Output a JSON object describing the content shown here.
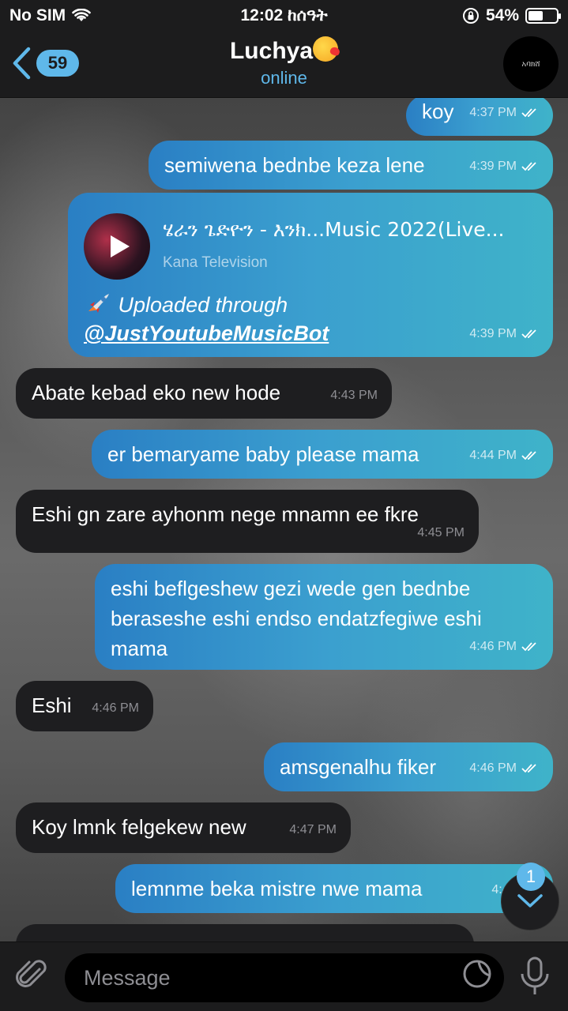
{
  "status_bar": {
    "carrier": "No SIM",
    "time": "12:02 ከሰዓት",
    "battery_percent": "54%",
    "battery_level": 0.54
  },
  "header": {
    "back_count": "59",
    "title": "Luchya",
    "status": "online",
    "avatar_text": "አባክሸ"
  },
  "messages": [
    {
      "dir": "out",
      "text": "koy",
      "time": "4:37 PM"
    },
    {
      "dir": "out",
      "text": "semiwena bednbe keza lene",
      "time": "4:39 PM"
    },
    {
      "dir": "out",
      "type": "media",
      "media_title": "ሄራን ጌድዮን - እንክ...Music 2022(Live...",
      "media_sub": "Kana Television",
      "caption": "Uploaded through",
      "caption_link": "@JustYoutubeMusicBot",
      "time": "4:39 PM"
    },
    {
      "dir": "in",
      "text": "Abate kebad eko new hode",
      "time": "4:43 PM"
    },
    {
      "dir": "out",
      "text": "er bemaryame baby please mama",
      "time": "4:44 PM"
    },
    {
      "dir": "in",
      "text": "Eshi gn zare ayhonm nege mnamn ee fkre",
      "time": "4:45 PM"
    },
    {
      "dir": "out",
      "text": "eshi beflgeshew gezi wede gen bednbe beraseshe eshi endso endatzfegiwe eshi mama",
      "time": "4:46 PM"
    },
    {
      "dir": "in",
      "text": "Eshi",
      "time": "4:46 PM"
    },
    {
      "dir": "out",
      "text": "amsgenalhu fiker",
      "time": "4:46 PM"
    },
    {
      "dir": "in",
      "text": "Koy lmnk felgekew new",
      "time": "4:47 PM"
    },
    {
      "dir": "out",
      "text": "lemnme beka mistre nwe mama",
      "time": "4:47 PM"
    }
  ],
  "scroll_badge": "1",
  "input": {
    "placeholder": "Message"
  },
  "colors": {
    "accent": "#5fb8ea",
    "outgoing_start": "#2a7fc4",
    "outgoing_end": "#3fb3c9",
    "incoming": "#1e1e20",
    "bar": "#1c1c1d"
  }
}
